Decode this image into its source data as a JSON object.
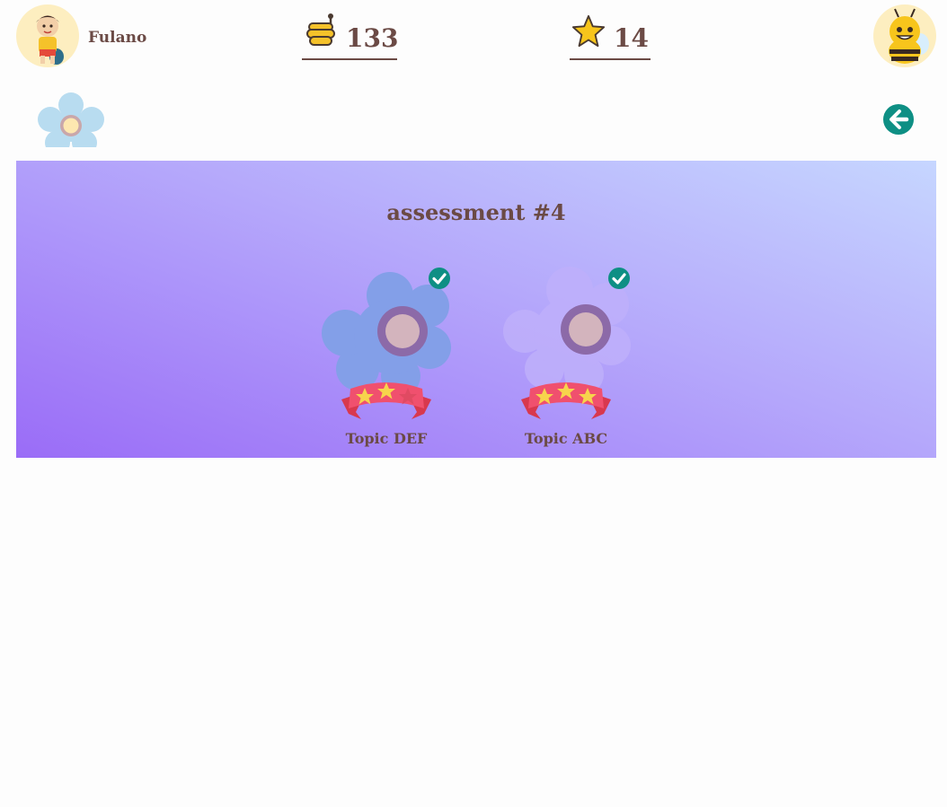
{
  "header": {
    "username": "Fulano",
    "honey_count": "133",
    "star_count": "14",
    "avatar_icon": "child-avatar-icon",
    "honey_icon": "honey-pot-icon",
    "star_icon": "star-icon",
    "bee_icon": "bee-mascot-icon"
  },
  "nav": {
    "flower_icon": "flower-icon",
    "back_icon": "arrow-left-circle-icon"
  },
  "assessment": {
    "title": "assessment #4",
    "topics": [
      {
        "label": "Topic DEF",
        "completed": true,
        "stars_earned": 2,
        "stars_total": 3
      },
      {
        "label": "Topic ABC",
        "completed": true,
        "stars_earned": 3,
        "stars_total": 3
      }
    ]
  },
  "colors": {
    "text": "#6b4a45",
    "accent_teal": "#0e8f84",
    "ribbon": "#f0506e",
    "star_gold": "#f7d44c",
    "panel_top": "#c6d6ff",
    "panel_bottom": "#9a6cf7"
  }
}
